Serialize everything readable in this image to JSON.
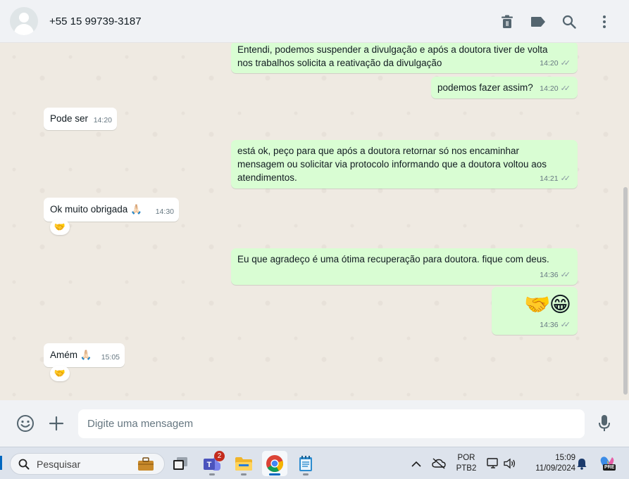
{
  "header": {
    "contact": "+55 15 99739-3187",
    "icons": [
      "delete-icon",
      "label-icon",
      "search-icon",
      "menu-icon"
    ]
  },
  "messages": [
    {
      "dir": "out",
      "lines": [
        "Entendi, podemos suspender a divulgação e após a doutora tiver de volta",
        "nos trabalhos solicita a reativação da divulgação"
      ],
      "time": "14:20",
      "ticks": "✓✓"
    },
    {
      "dir": "out",
      "lines": [
        "podemos fazer assim?"
      ],
      "time": "14:20",
      "ticks": "✓✓"
    },
    {
      "dir": "in",
      "lines": [
        "Pode ser"
      ],
      "time": "14:20"
    },
    {
      "dir": "out",
      "lines": [
        "está ok, peço para que após a doutora retornar só nos encaminhar",
        "mensagem ou solicitar via protocolo informando que a doutora voltou aos",
        "atendimentos."
      ],
      "time": "14:21",
      "ticks": "✓✓"
    },
    {
      "dir": "in",
      "lines": [
        "Ok muito obrigada 🙏🏻"
      ],
      "time": "14:30",
      "reaction": "🤝"
    },
    {
      "dir": "out",
      "lines": [
        "Eu que agradeço é uma ótima recuperação para doutora. fique com deus."
      ],
      "time": "14:36",
      "ticks": "✓✓"
    },
    {
      "dir": "out",
      "lines": [
        "🤝😁"
      ],
      "time": "14:36",
      "ticks": "✓✓"
    },
    {
      "dir": "in",
      "lines": [
        "Amém 🙏🏻"
      ],
      "time": "15:05",
      "reaction": "🤝"
    }
  ],
  "composer": {
    "placeholder": "Digite uma mensagem"
  },
  "taskbar": {
    "search_label": "Pesquisar",
    "teams_badge": "2",
    "lang_1": "POR",
    "lang_2": "PTB2",
    "time": "15:09",
    "date": "11/09/2024",
    "copilot_badge": "PRE"
  },
  "colors": {
    "outgoing_bubble": "#d9fdd3",
    "incoming_bubble": "#ffffff",
    "chat_background": "#efeae2",
    "header_background": "#f0f2f5"
  }
}
